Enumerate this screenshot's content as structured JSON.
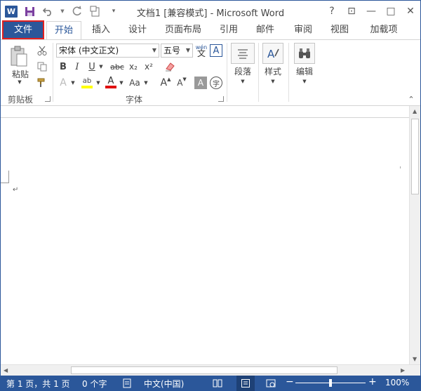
{
  "window": {
    "title": "文档1 [兼容模式] - Microsoft Word",
    "help": "?",
    "ribbon_display": "⊡",
    "minimize": "—",
    "restore": "□",
    "close": "✕"
  },
  "qat": {
    "logo": "W",
    "save_icon": "save-icon",
    "undo_icon": "undo-icon",
    "redo_icon": "redo-icon",
    "new_doc_icon": "new-document-icon",
    "customize_icon": "customize-qat-icon"
  },
  "tabs": {
    "file": "文件",
    "home": "开始",
    "insert": "插入",
    "design": "设计",
    "layout": "页面布局",
    "references": "引用",
    "mailings": "邮件",
    "review": "审阅",
    "view": "视图",
    "addins": "加载项"
  },
  "ribbon": {
    "clipboard": {
      "label": "剪贴板",
      "paste": "粘贴"
    },
    "font": {
      "label": "字体",
      "font_name": "宋体 (中文正文)",
      "font_size": "五号",
      "bold": "B",
      "italic": "I",
      "underline": "U",
      "strike": "abc",
      "subscript": "x₂",
      "superscript": "x²",
      "font_color_letter": "A",
      "case": "Aa",
      "grow": "A",
      "shrink": "A",
      "phonetic": "wén",
      "char_border": "A",
      "char_shading": "A",
      "enclose": "字",
      "text_effect": "A",
      "highlight": "ab",
      "highlight_color": "#ffff00",
      "font_color": "#e01010"
    },
    "paragraph": {
      "label": "段落"
    },
    "styles": {
      "label": "样式"
    },
    "editing": {
      "label": "编辑"
    }
  },
  "document": {
    "paragraph_mark": "↵"
  },
  "status": {
    "page": "第 1 页，共 1 页",
    "words": "0 个字",
    "language": "中文(中国)",
    "zoom": "100%",
    "zoom_minus": "−",
    "zoom_plus": "+"
  },
  "colors": {
    "accent": "#2b579a",
    "file_tab_outline": "#e02020"
  }
}
